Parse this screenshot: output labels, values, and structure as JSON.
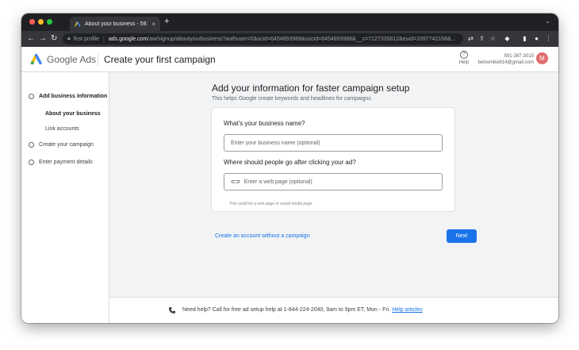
{
  "browser": {
    "tab_title": "About your business - 591-3(",
    "profile_label": "first profile",
    "url_host": "ads.google.com",
    "url_path": "/aw/signup/aboutyourbusiness?authuser=0&ocid=6454893988&uscid=6454893988&__c=7127335812&euid=1097742168&...",
    "new_tab": "+",
    "tab_close": "×"
  },
  "header": {
    "brand": "Google Ads",
    "page_title": "Create your first campaign",
    "help_label": "Help",
    "account_id": "591-387-3015",
    "account_email": "belovmike814@gmail.com",
    "avatar_letter": "M"
  },
  "sidebar": {
    "steps": [
      {
        "label": "Add business information",
        "active": true
      },
      {
        "label": "Create your campaign",
        "active": false
      },
      {
        "label": "Enter payment details",
        "active": false
      }
    ],
    "substeps": [
      {
        "label": "About your business",
        "active": true
      },
      {
        "label": "Link accounts",
        "active": false
      }
    ]
  },
  "main": {
    "heading": "Add your information for faster campaign setup",
    "subheading": "This helps Google create keywords and headlines for campaigns",
    "q_business_name": "What's your business name?",
    "business_name_placeholder": "Enter your business name (optional)",
    "q_destination": "Where should people go after clicking your ad?",
    "webpage_placeholder": "Enter a web page (optional)",
    "webpage_hint": "This could be a web page or social media page",
    "no_campaign_link": "Create an account without a campaign",
    "next_button": "Next"
  },
  "footer": {
    "text": "Need help? Call for free ad setup help at 1-844-224-2040, 9am to 9pm ET, Mon - Fri.",
    "link": "Help articles"
  },
  "colors": {
    "accent": "#1a73e8",
    "chrome_dark": "#202124",
    "chrome_toolbar": "#35363a",
    "main_bg": "#f1f3f4",
    "avatar": "#e06b6b"
  }
}
